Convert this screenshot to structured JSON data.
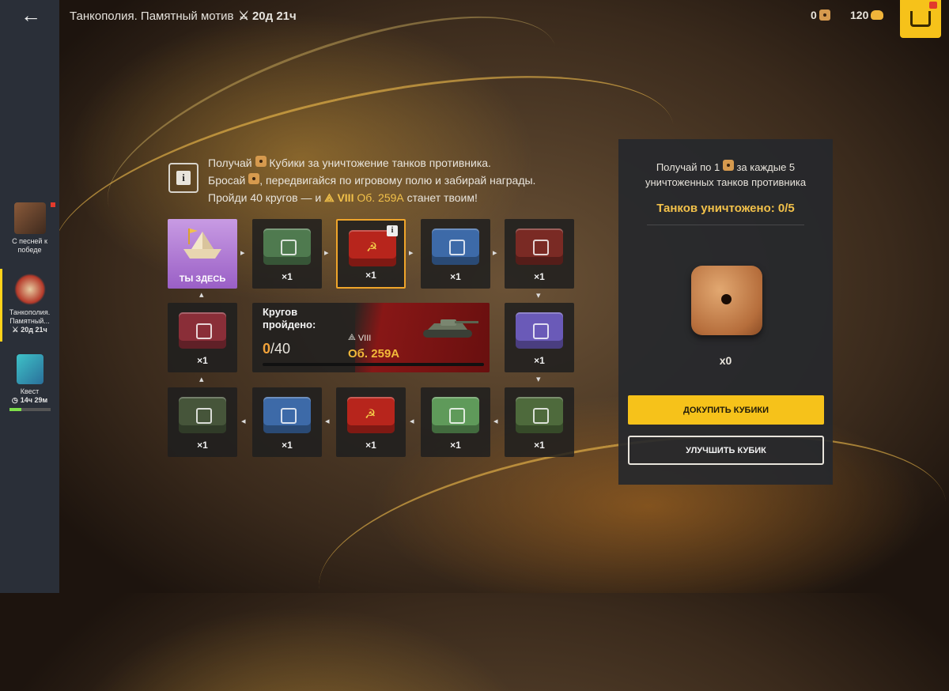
{
  "header": {
    "title": "Танкополия. Памятный мотив",
    "timer": "20д 21ч",
    "dice_count": "0",
    "gold": "120"
  },
  "sidebar": {
    "items": [
      {
        "label": "С песней к победе",
        "icon": "accordion-icon"
      },
      {
        "label": "Танкополия. Памятный...",
        "timer": "20д 21ч",
        "icon": "paper-boat-icon"
      },
      {
        "label": "Квест",
        "timer": "14ч 29м",
        "icon": "quest-tag-icon"
      }
    ]
  },
  "info": {
    "line1_a": "Получай",
    "line1_b": "Кубики за уничтожение танков противника.",
    "line2_a": "Бросай",
    "line2_b": ", передвигайся по игровому полю и забирай награды.",
    "line3_a": "Пройди 40 кругов — и",
    "line3_tier": "VIII",
    "line3_tank": "Об. 259А",
    "line3_b": "станет твоим!"
  },
  "board": {
    "start_label": "ТЫ ЗДЕСЬ",
    "cells": [
      {
        "qty": "×1",
        "color": "#4f7a4f"
      },
      {
        "qty": "×1",
        "color": "#b7251c",
        "soviet": true,
        "current": true
      },
      {
        "qty": "×1",
        "color": "#3d6aa8"
      },
      {
        "qty": "×1",
        "color": "#7a2a24"
      },
      {
        "qty": "×1",
        "color": "#6a5ab8"
      },
      {
        "qty": "×1",
        "color": "#4e6a3c"
      },
      {
        "qty": "×1",
        "color": "#5f9a5a"
      },
      {
        "qty": "×1",
        "color": "#b7251c",
        "soviet": true
      },
      {
        "qty": "×1",
        "color": "#3d6aa8"
      },
      {
        "qty": "×1",
        "color": "#46553a"
      },
      {
        "qty": "×1",
        "color": "#8a2e38"
      }
    ]
  },
  "progress": {
    "label": "Кругов пройдено:",
    "current": "0",
    "total": "/40",
    "tier": "VIII",
    "tank": "Об. 259А",
    "fraction": 0
  },
  "panel": {
    "desc_a": "Получай по 1",
    "desc_b": "за каждые 5",
    "desc_c": "уничтоженных танков противника",
    "killed": "Танков уничтожено: 0/5",
    "dice_qty": "x0",
    "buy_label": "ДОКУПИТЬ КУБИКИ",
    "upgrade_label": "УЛУЧШИТЬ КУБИК"
  }
}
